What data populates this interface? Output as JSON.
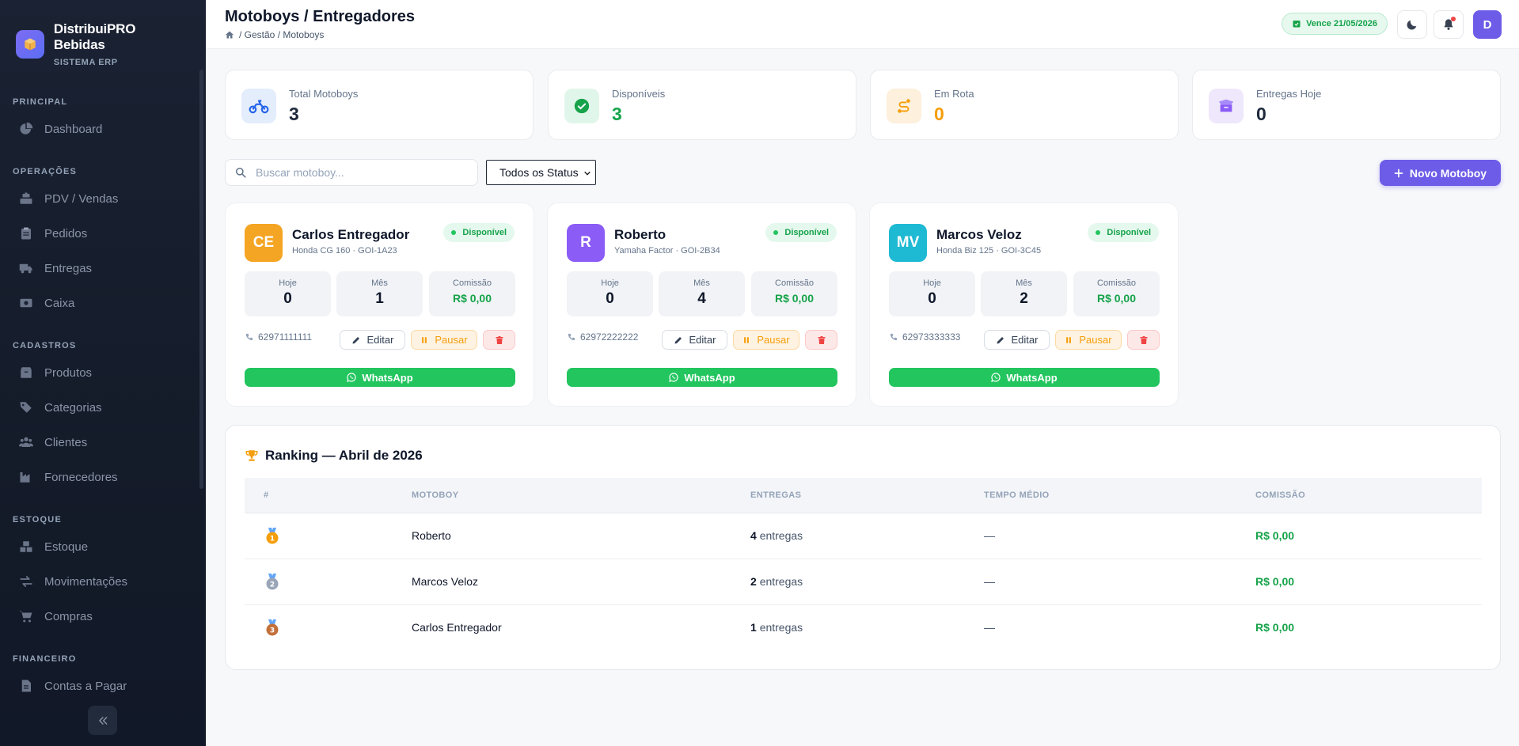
{
  "brand": {
    "name": "DistribuiPRO Bebidas",
    "subtitle": "SISTEMA ERP"
  },
  "sidebar": {
    "sections": [
      {
        "title": "PRINCIPAL",
        "items": [
          {
            "label": "Dashboard",
            "icon": "pie-chart-icon"
          }
        ]
      },
      {
        "title": "OPERAÇÕES",
        "items": [
          {
            "label": "PDV / Vendas",
            "icon": "cash-register-icon"
          },
          {
            "label": "Pedidos",
            "icon": "clipboard-icon"
          },
          {
            "label": "Entregas",
            "icon": "truck-icon"
          },
          {
            "label": "Caixa",
            "icon": "cash-icon"
          }
        ]
      },
      {
        "title": "CADASTROS",
        "items": [
          {
            "label": "Produtos",
            "icon": "box-icon"
          },
          {
            "label": "Categorias",
            "icon": "tags-icon"
          },
          {
            "label": "Clientes",
            "icon": "users-icon"
          },
          {
            "label": "Fornecedores",
            "icon": "industry-icon"
          }
        ]
      },
      {
        "title": "ESTOQUE",
        "items": [
          {
            "label": "Estoque",
            "icon": "boxes-icon"
          },
          {
            "label": "Movimentações",
            "icon": "exchange-icon"
          },
          {
            "label": "Compras",
            "icon": "cart-icon"
          }
        ]
      },
      {
        "title": "FINANCEIRO",
        "items": [
          {
            "label": "Contas a Pagar",
            "icon": "invoice-icon"
          }
        ]
      }
    ]
  },
  "header": {
    "title": "Motoboys / Entregadores",
    "breadcrumb": "/ Gestão / Motoboys",
    "expiry": "Vence 21/05/2026",
    "avatar": "D"
  },
  "stats": [
    {
      "label": "Total Motoboys",
      "value": "3",
      "icon": "motorcycle-icon",
      "color": "#1e293b",
      "bg": "#e3edfc",
      "fg": "#2563eb"
    },
    {
      "label": "Disponíveis",
      "value": "3",
      "icon": "check-circle-icon",
      "color": "#16a34a",
      "bg": "#e1f6ea",
      "fg": "#16a34a"
    },
    {
      "label": "Em Rota",
      "value": "0",
      "icon": "route-icon",
      "color": "#f59e0b",
      "bg": "#fdf0dc",
      "fg": "#f59e0b"
    },
    {
      "label": "Entregas Hoje",
      "value": "0",
      "icon": "box-open-icon",
      "color": "#1e293b",
      "bg": "#efe7fb",
      "fg": "#8b5cf6"
    }
  ],
  "toolbar": {
    "search_placeholder": "Buscar motoboy...",
    "status_filter": "Todos os Status",
    "new_button": "Novo Motoboy"
  },
  "couriers": [
    {
      "initials": "CE",
      "color": "#f5a524",
      "name": "Carlos Entregador",
      "bike": "Honda CG 160 · GOI-1A23",
      "status": "Disponível",
      "today": "0",
      "month": "1",
      "commission": "R$ 0,00",
      "phone": "62971111111"
    },
    {
      "initials": "R",
      "color": "#8b5cf6",
      "name": "Roberto",
      "bike": "Yamaha Factor · GOI-2B34",
      "status": "Disponível",
      "today": "0",
      "month": "4",
      "commission": "R$ 0,00",
      "phone": "62972222222"
    },
    {
      "initials": "MV",
      "color": "#1eb9d3",
      "name": "Marcos Veloz",
      "bike": "Honda Biz 125 · GOI-3C45",
      "status": "Disponível",
      "today": "0",
      "month": "2",
      "commission": "R$ 0,00",
      "phone": "62973333333"
    }
  ],
  "card_labels": {
    "today": "Hoje",
    "month": "Mês",
    "commission": "Comissão",
    "edit": "Editar",
    "pause": "Pausar",
    "whatsapp": "WhatsApp"
  },
  "ranking": {
    "title": "Ranking — Abril de 2026",
    "headers": {
      "rank": "#",
      "courier": "MOTOBOY",
      "deliveries": "ENTREGAS",
      "avg_time": "TEMPO MÉDIO",
      "commission": "COMISSÃO"
    },
    "deliveries_suffix": "entregas",
    "rows": [
      {
        "medal": "1",
        "medal_color": "#f59e0b",
        "name": "Roberto",
        "count": "4",
        "avg_time": "—",
        "commission": "R$ 0,00"
      },
      {
        "medal": "2",
        "medal_color": "#9aa5b8",
        "name": "Marcos Veloz",
        "count": "2",
        "avg_time": "—",
        "commission": "R$ 0,00"
      },
      {
        "medal": "3",
        "medal_color": "#c2703a",
        "name": "Carlos Entregador",
        "count": "1",
        "avg_time": "—",
        "commission": "R$ 0,00"
      }
    ]
  }
}
